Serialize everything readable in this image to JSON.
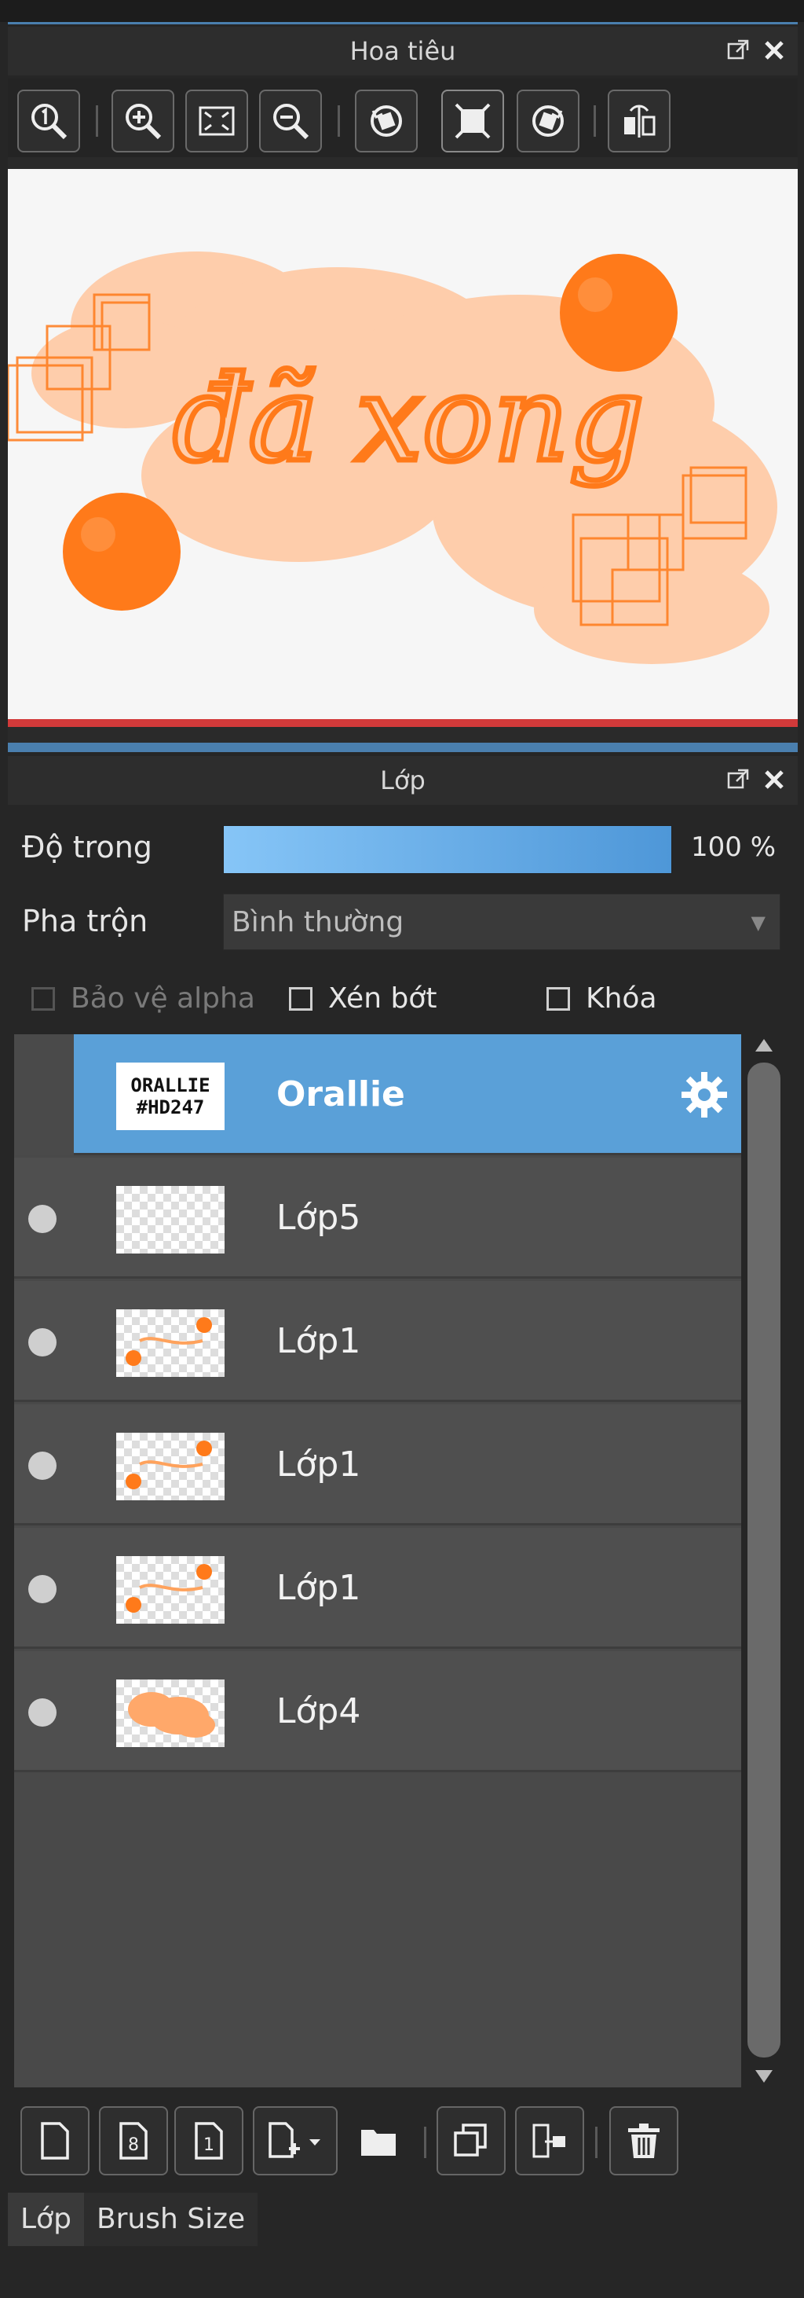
{
  "navigator": {
    "title": "Hoa tiêu",
    "toolbar_icons": [
      "zoom-reset-icon",
      "zoom-in-icon",
      "fit-screen-icon",
      "zoom-out-icon",
      "rotate-left-icon",
      "actual-size-icon",
      "rotate-right-icon",
      "flip-horizontal-icon"
    ],
    "artwork_text": "đã xong"
  },
  "layers_panel": {
    "title": "Lớp",
    "opacity_label": "Độ trong",
    "opacity_value": "100 %",
    "opacity_fraction": 1.0,
    "blend_label": "Pha trộn",
    "blend_value": "Bình thường",
    "protect_alpha_label": "Bảo vệ alpha",
    "clip_label": "Xén bớt",
    "lock_label": "Khóa",
    "selected_thumb_line1": "ORALLIE",
    "selected_thumb_line2": "#HD247",
    "layers": [
      {
        "name": "Orallie",
        "selected": true
      },
      {
        "name": "Lớp5",
        "selected": false
      },
      {
        "name": "Lớp1",
        "selected": false
      },
      {
        "name": "Lớp1",
        "selected": false
      },
      {
        "name": "Lớp1",
        "selected": false
      },
      {
        "name": "Lớp4",
        "selected": false
      }
    ]
  },
  "tabs": [
    {
      "label": "Lớp",
      "active": true
    },
    {
      "label": "Brush Size",
      "active": false
    }
  ],
  "colors": {
    "accent": "#5aa0d8",
    "artwork_orange": "#ff7a1a",
    "artwork_peach": "#ffc9a3"
  }
}
